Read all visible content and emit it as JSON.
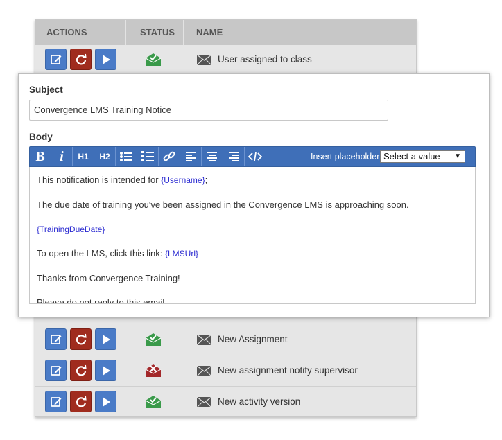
{
  "table": {
    "headers": {
      "actions": "ACTIONS",
      "status": "STATUS",
      "name": "NAME"
    },
    "rows": [
      {
        "status": "sent",
        "status_color": "#3a9a4a",
        "name": "User assigned to class"
      },
      {
        "status": "sent",
        "status_color": "#3a9a4a",
        "name": "New Assignment"
      },
      {
        "status": "failed",
        "status_color": "#a3282a",
        "name": "New assignment notify supervisor"
      },
      {
        "status": "sent",
        "status_color": "#3a9a4a",
        "name": "New activity version"
      }
    ]
  },
  "editor": {
    "subject_label": "Subject",
    "subject_value": "Convergence LMS Training Notice",
    "body_label": "Body",
    "toolbar": {
      "bold": "B",
      "italic": "i",
      "h1": "H1",
      "h2": "H2",
      "insert_placeholder_label": "Insert placeholder",
      "placeholder_select_value": "Select a value"
    },
    "body": {
      "line1_text": "This notification is intended for ",
      "line1_placeholder": "{Username}",
      "line1_suffix": ";",
      "line2": "The due date of training you've been assigned in the Convergence LMS is approaching soon.",
      "line3_placeholder": "{TrainingDueDate}",
      "line4_text": "To open the LMS, click this link: ",
      "line4_placeholder": "{LMSUrl}",
      "line5": "Thanks from Convergence Training!",
      "line6": "Please do not reply to this email."
    }
  },
  "colors": {
    "accent_blue": "#4a7bc7",
    "refresh_red": "#a02c1e",
    "toolbar_blue": "#3f6fb8",
    "placeholder_text": "#2b2bd1"
  }
}
